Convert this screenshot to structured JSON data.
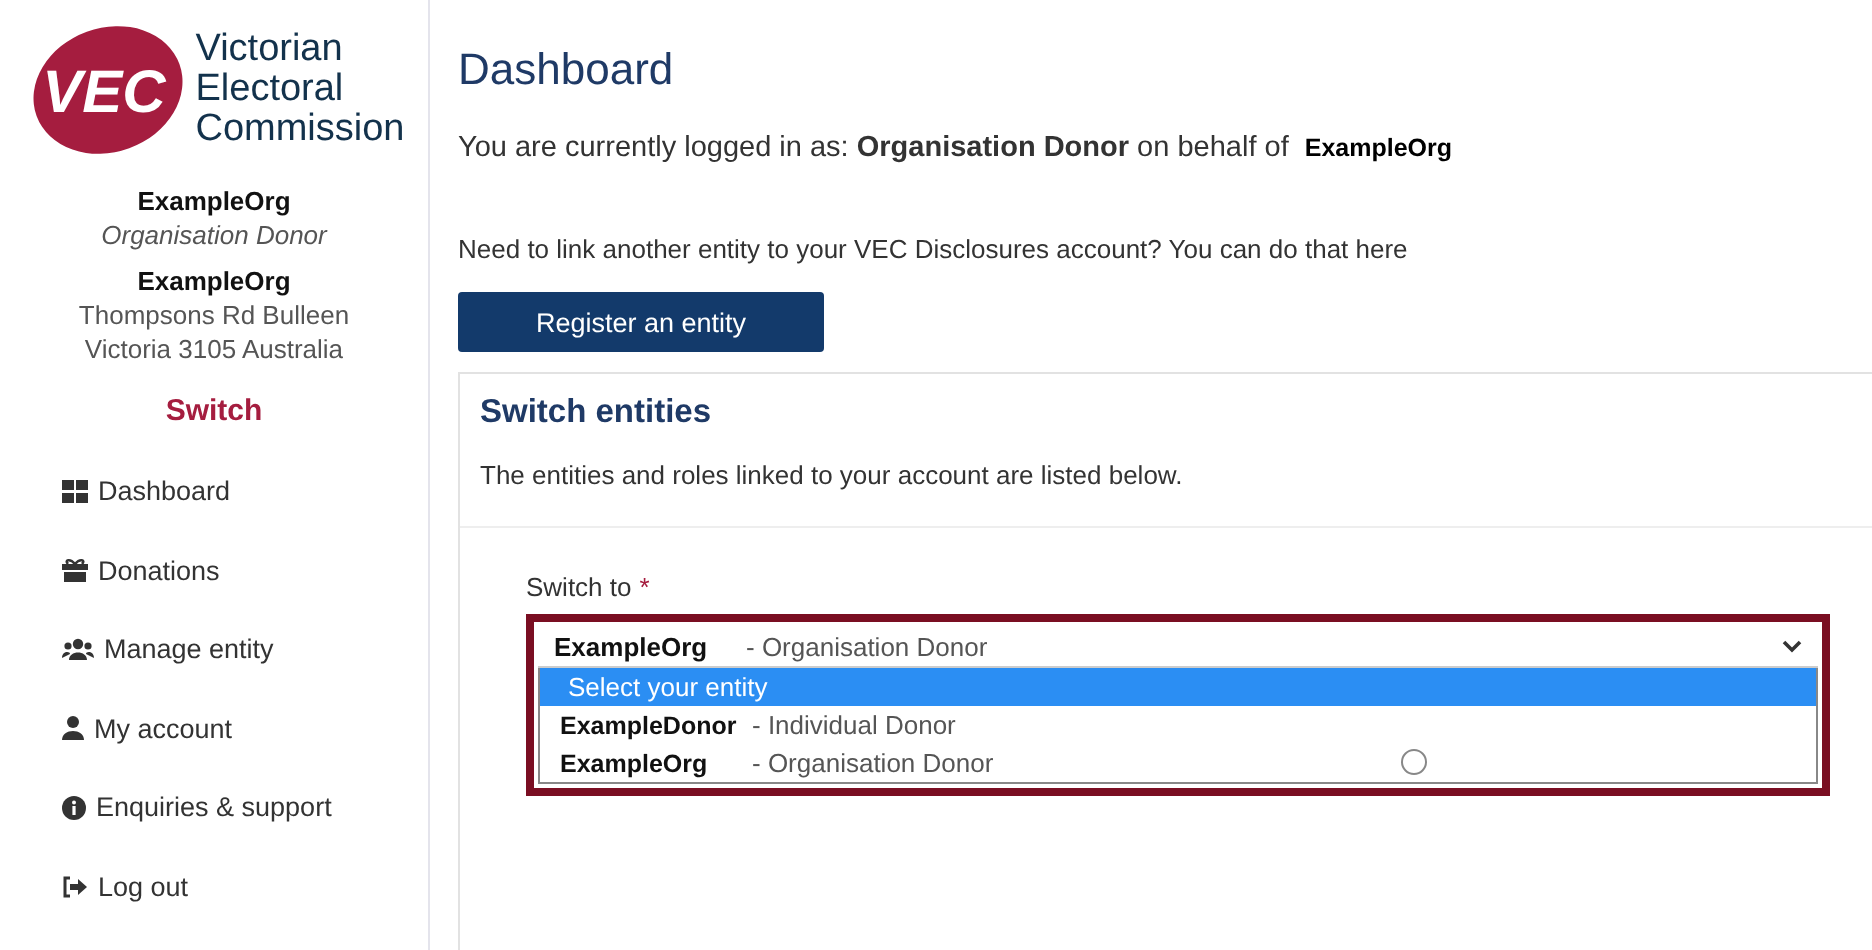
{
  "logo": {
    "mark": "VEC",
    "name_lines": [
      "Victorian",
      "Electoral",
      "Commission"
    ]
  },
  "profile": {
    "name": "ExampleOrg",
    "role": "Organisation Donor",
    "entity_name": "ExampleOrg",
    "address_lines": [
      "Thompsons Rd Bulleen",
      "Victoria 3105 Australia"
    ],
    "switch_link": "Switch"
  },
  "nav": [
    {
      "kind": "grid",
      "label": "Dashboard"
    },
    {
      "kind": "gift",
      "label": "Donations"
    },
    {
      "kind": "users",
      "label": "Manage entity"
    },
    {
      "kind": "user",
      "label": "My account"
    },
    {
      "kind": "info",
      "label": "Enquiries & support"
    },
    {
      "kind": "logout",
      "label": "Log out"
    }
  ],
  "main": {
    "title": "Dashboard",
    "login_line": {
      "prefix": "You are currently logged in as:",
      "role": "Organisation Donor",
      "middle": "on behalf of",
      "org": "ExampleOrg"
    },
    "link_prompt": "Need to link another entity to your VEC Disclosures account? You can do that here",
    "register_button": "Register an entity",
    "card": {
      "title": "Switch entities",
      "subtitle": "The entities and roles linked to your account are listed below.",
      "field": {
        "label": "Switch to",
        "required_mark": "*",
        "value": {
          "name": "ExampleOrg",
          "role": "- Organisation Donor"
        },
        "options": [
          {
            "kind": "placeholder",
            "label": "Select your entity",
            "selected": true
          },
          {
            "kind": "entity",
            "name": "ExampleDonor",
            "role": "- Individual Donor",
            "selected": false
          },
          {
            "kind": "entity",
            "name": "ExampleOrg",
            "role": "- Organisation Donor",
            "selected": false
          }
        ]
      }
    }
  }
}
